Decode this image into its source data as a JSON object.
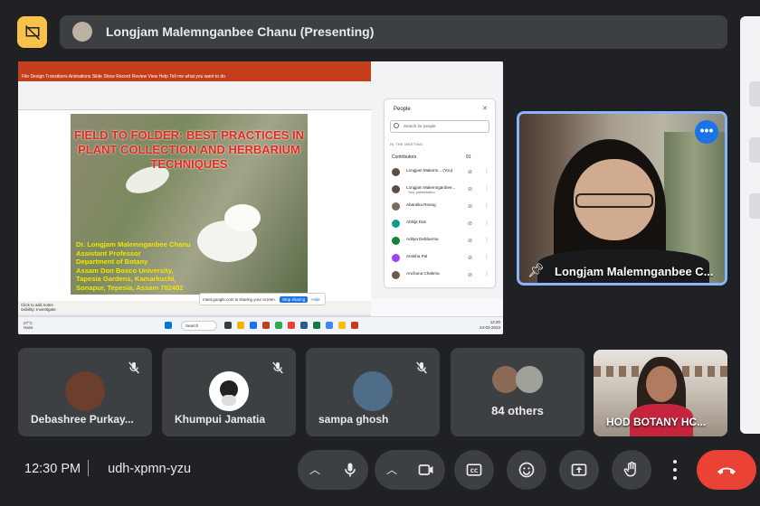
{
  "header": {
    "presenter_title": "Longjam Malemnganbee Chanu (Presenting)",
    "top_icon": "presentation-off-icon"
  },
  "shared_screen": {
    "ppt_menu": "File  Design  Transitions  Animations  Slide Show  Record  Review  View  Help   Tell me what you want to do",
    "slide_title": "FIELD TO FOLDER: BEST PRACTICES IN PLANT COLLECTION AND HERBARIUM TECHNIQUES",
    "slide_author": [
      "Dr. Longjam Malemnganbee Chanu",
      "Assistant Professor",
      "Department of Botany",
      "Assam Don Bosco University,",
      "Tapesia Gardens, Kamarkuchi,",
      "Sonapur, Tepesia, Assam 782402"
    ],
    "ppt_status": "Click to add notes",
    "ppt_status2": "ssibility: Investigate",
    "share_toast": "meet.google.com is sharing your screen.",
    "stop_sharing": "Stop sharing",
    "hide": "Hide",
    "people_panel": {
      "title": "People",
      "search_placeholder": "Search for people",
      "in_meeting": "IN THE MEETING",
      "contributors_label": "Contributors",
      "contributors_count": "91",
      "people": [
        {
          "name": "Longjam Malemn...  (You)",
          "sub": "",
          "color": "#5f4b44"
        },
        {
          "name": "Longjam Malemnganbee...",
          "sub": "Your presentation",
          "color": "#5f4b44"
        },
        {
          "name": "Abantika Reang",
          "sub": "",
          "color": "#7a6a58"
        },
        {
          "name": "Abhijit Das",
          "sub": "",
          "color": "#0f9d8a"
        },
        {
          "name": "Aditya Debbarma",
          "sub": "",
          "color": "#188038"
        },
        {
          "name": "Amisha Pal",
          "sub": "",
          "color": "#a142f4"
        },
        {
          "name": "Anchana Chakma",
          "sub": "",
          "color": "#6b5a4c"
        }
      ]
    },
    "taskbar": {
      "weather_temp": "27°C",
      "weather_desc": "Haze",
      "search": "Search",
      "time": "12:30",
      "date": "24-03-2023"
    }
  },
  "presenter_tile": {
    "name": "Longjam Malemnganbee C...",
    "more_icon": "more-vert-icon",
    "pin_icon": "pin-icon"
  },
  "participants": [
    {
      "name": "Debashree Purkay...",
      "avatar_color": "#6b3e2e",
      "muted": true
    },
    {
      "name": "Khumpui Jamatia",
      "avatar_color": "#ffffff",
      "muted": true
    },
    {
      "name": "sampa ghosh",
      "avatar_color": "#4f6d86",
      "muted": true
    }
  ],
  "others": {
    "label": "84 others"
  },
  "hod_tile": {
    "name": "HOD BOTANY HC..."
  },
  "bottom_bar": {
    "time": "12:30 PM",
    "meeting_code": "udh-xpmn-yzu",
    "controls": [
      "mic-icon",
      "camera-icon",
      "captions-icon",
      "emoji-icon",
      "present-icon",
      "raise-hand-icon",
      "more-options-icon",
      "leave-call-icon"
    ]
  },
  "colors": {
    "background": "#202124",
    "tile": "#3c4043",
    "accent_blue": "#8ab4f8",
    "leave_red": "#ea4335",
    "top_icon_yellow": "#f7c24a"
  }
}
